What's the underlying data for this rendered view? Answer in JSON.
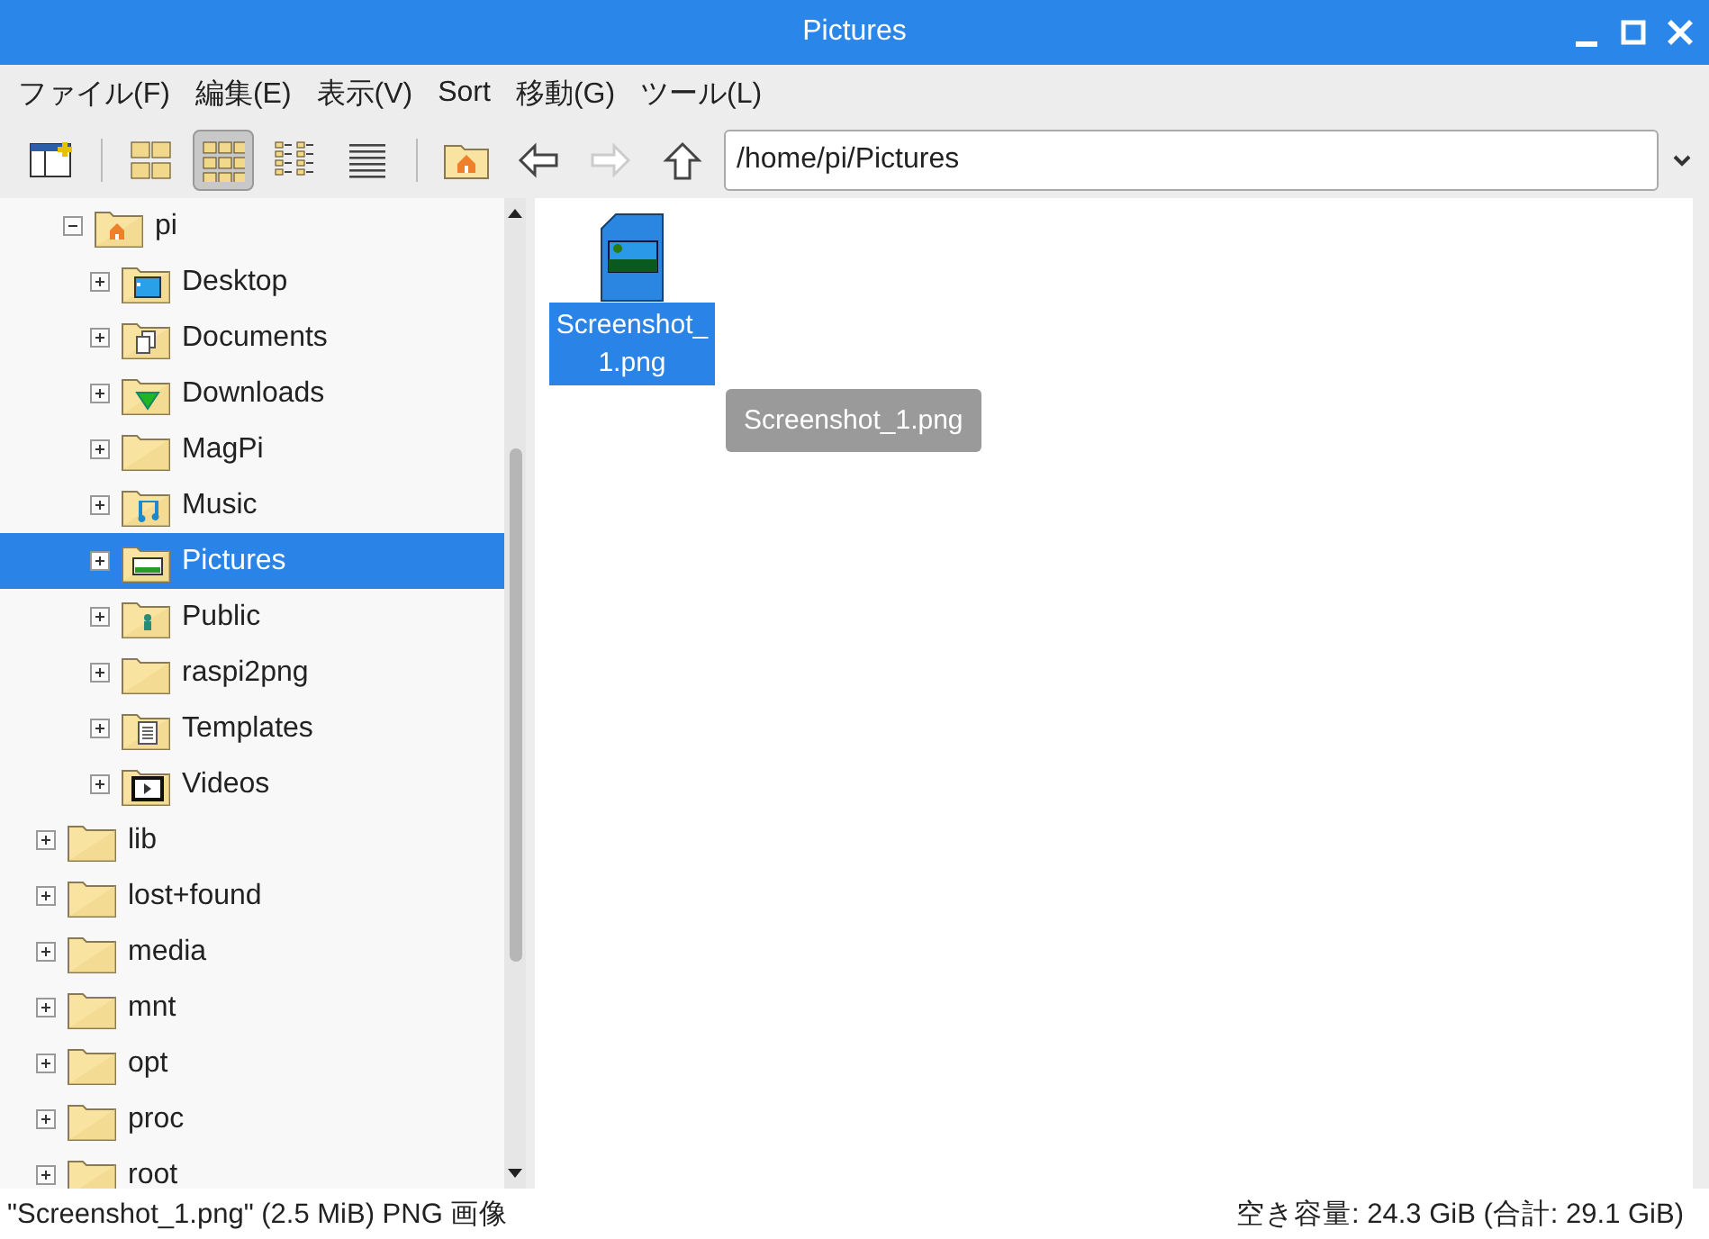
{
  "window": {
    "title": "Pictures"
  },
  "menu": [
    "ファイル(F)",
    "編集(E)",
    "表示(V)",
    "Sort",
    "移動(G)",
    "ツール(L)"
  ],
  "toolbar": {
    "views": [
      {
        "kind": "icons",
        "selected": false
      },
      {
        "kind": "thumbnails",
        "selected": true
      },
      {
        "kind": "compact",
        "selected": false
      },
      {
        "kind": "list",
        "selected": false
      }
    ],
    "back_disabled": false,
    "forward_disabled": true,
    "path": "/home/pi/Pictures"
  },
  "tree": [
    {
      "kind": "parent",
      "children": [
        {
          "label": "pi",
          "kind": "home",
          "expanded": true,
          "selected": false,
          "children": [
            {
              "label": "Desktop",
              "kind": "desktop",
              "expanded": false,
              "selected": false
            },
            {
              "label": "Documents",
              "kind": "documents",
              "expanded": false,
              "selected": false
            },
            {
              "label": "Downloads",
              "kind": "downloads",
              "expanded": false,
              "selected": false
            },
            {
              "label": "MagPi",
              "kind": "folder",
              "expanded": false,
              "selected": false
            },
            {
              "label": "Music",
              "kind": "music",
              "expanded": false,
              "selected": false
            },
            {
              "label": "Pictures",
              "kind": "pictures",
              "expanded": false,
              "selected": true
            },
            {
              "label": "Public",
              "kind": "public",
              "expanded": false,
              "selected": false
            },
            {
              "label": "raspi2png",
              "kind": "folder",
              "expanded": false,
              "selected": false
            },
            {
              "label": "Templates",
              "kind": "templates",
              "expanded": false,
              "selected": false
            },
            {
              "label": "Videos",
              "kind": "videos",
              "expanded": false,
              "selected": false
            }
          ]
        }
      ]
    },
    {
      "label": "lib",
      "kind": "folder",
      "expanded": false,
      "selected": false
    },
    {
      "label": "lost+found",
      "kind": "folder",
      "expanded": false,
      "selected": false
    },
    {
      "label": "media",
      "kind": "folder",
      "expanded": false,
      "selected": false
    },
    {
      "label": "mnt",
      "kind": "folder",
      "expanded": false,
      "selected": false
    },
    {
      "label": "opt",
      "kind": "folder",
      "expanded": false,
      "selected": false
    },
    {
      "label": "proc",
      "kind": "folder",
      "expanded": false,
      "selected": false
    },
    {
      "label": "root",
      "kind": "folder",
      "expanded": false,
      "selected": false
    }
  ],
  "files": [
    {
      "name": "Screenshot_\n1.png",
      "selected": true,
      "tooltip": "Screenshot_1.png"
    }
  ],
  "status_bar": {
    "left": "\"Screenshot_1.png\" (2.5 MiB) PNG 画像",
    "right": "空き容量: 24.3 GiB (合計: 29.1 GiB)"
  }
}
